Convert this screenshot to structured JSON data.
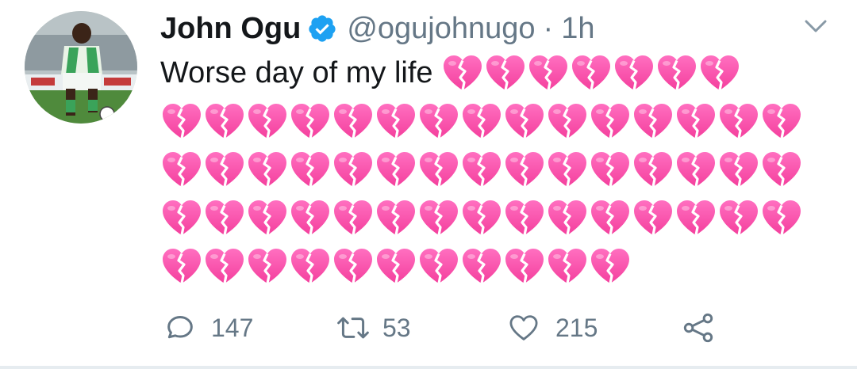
{
  "tweet": {
    "author": {
      "name": "John Ogu",
      "handle": "@ogujohnugo",
      "verified": true,
      "avatar_icon": "footballer-avatar"
    },
    "separator": "·",
    "time": "1h",
    "text": "Worse day of my life",
    "emoji": "broken-heart",
    "emoji_rows": [
      7,
      15,
      15,
      15,
      11
    ],
    "actions": {
      "reply_count": "147",
      "retweet_count": "53",
      "like_count": "215"
    }
  },
  "colors": {
    "verified_blue": "#1da1f2",
    "heart_pink": "#f43f9d",
    "icon_gray": "#657786",
    "divider": "#e6ecf0"
  }
}
